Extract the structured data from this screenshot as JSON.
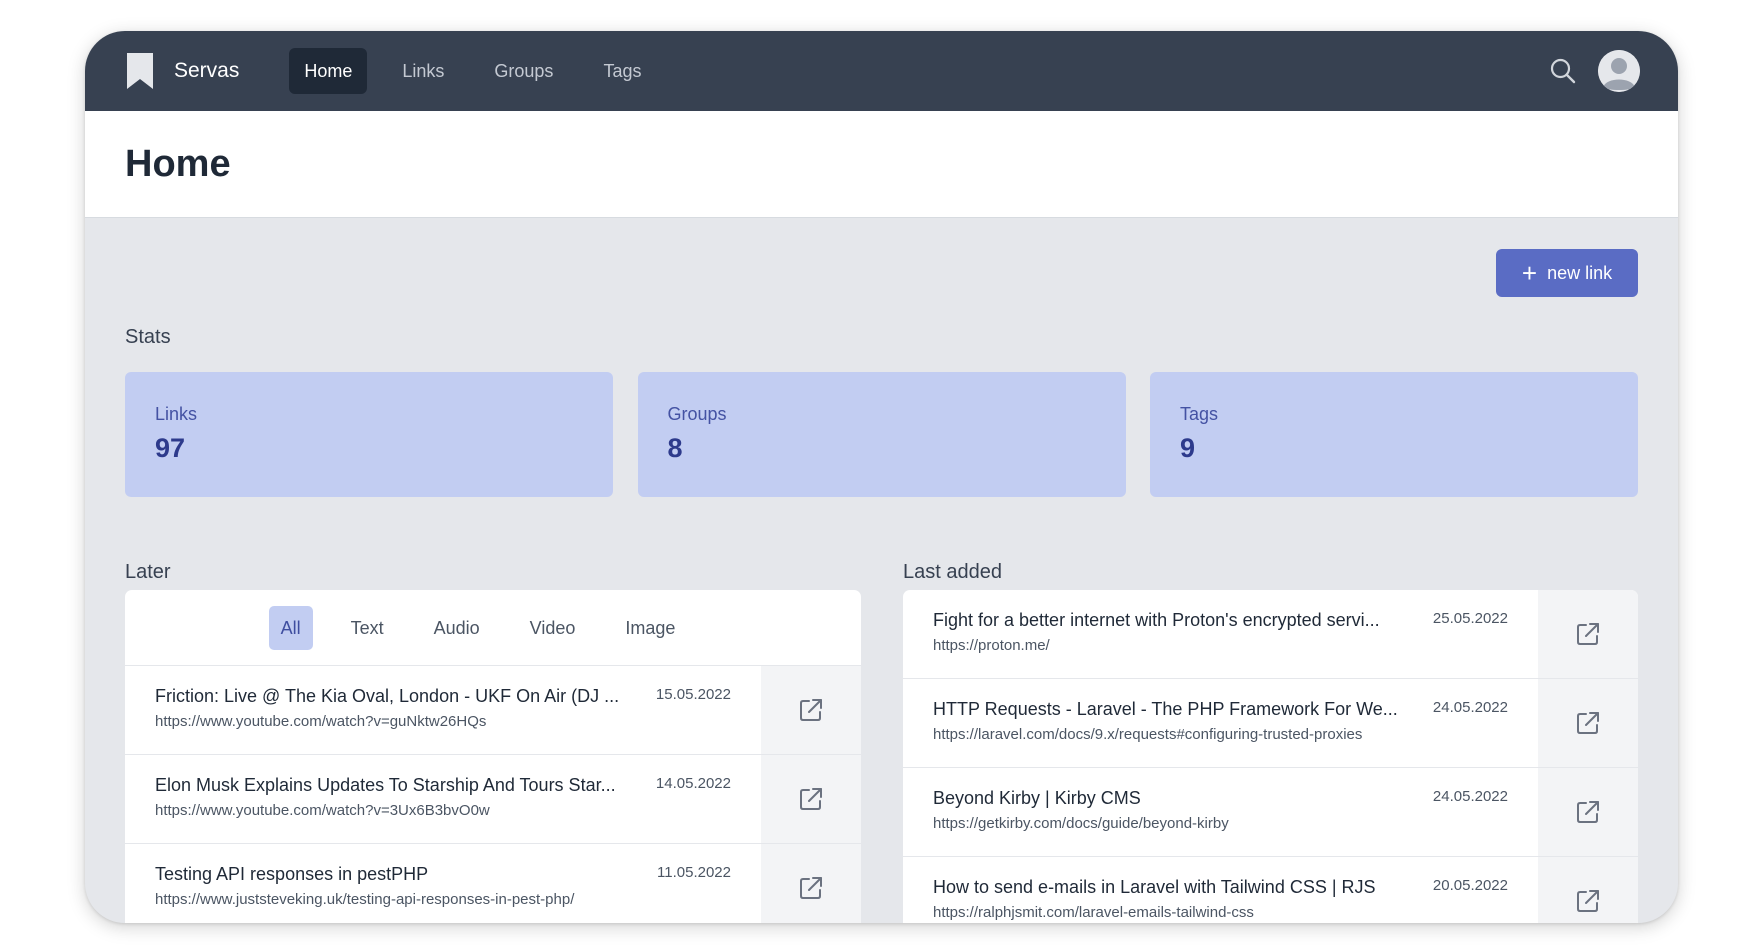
{
  "nav": {
    "brand": "Servas",
    "links": [
      {
        "label": "Home",
        "active": true
      },
      {
        "label": "Links",
        "active": false
      },
      {
        "label": "Groups",
        "active": false
      },
      {
        "label": "Tags",
        "active": false
      }
    ],
    "icons": {
      "search": "search-icon",
      "avatar": "user-avatar-icon",
      "logo": "bookmark-icon"
    }
  },
  "header": {
    "title": "Home"
  },
  "actions": {
    "new_link_label": "new link",
    "new_link_icon": "plus-icon"
  },
  "stats": {
    "label": "Stats",
    "cards": [
      {
        "label": "Links",
        "value": "97"
      },
      {
        "label": "Groups",
        "value": "8"
      },
      {
        "label": "Tags",
        "value": "9"
      }
    ]
  },
  "later": {
    "label": "Later",
    "filters": [
      {
        "label": "All",
        "active": true
      },
      {
        "label": "Text",
        "active": false
      },
      {
        "label": "Audio",
        "active": false
      },
      {
        "label": "Video",
        "active": false
      },
      {
        "label": "Image",
        "active": false
      }
    ],
    "items": [
      {
        "title": "Friction: Live @ The Kia Oval, London - UKF On Air (DJ ...",
        "url": "https://www.youtube.com/watch?v=guNktw26HQs",
        "date": "15.05.2022"
      },
      {
        "title": "Elon Musk Explains Updates To Starship And Tours Star...",
        "url": "https://www.youtube.com/watch?v=3Ux6B3bvO0w",
        "date": "14.05.2022"
      },
      {
        "title": "Testing API responses in pestPHP",
        "url": "https://www.juststeveking.uk/testing-api-responses-in-pest-php/",
        "date": "11.05.2022"
      }
    ]
  },
  "last_added": {
    "label": "Last added",
    "items": [
      {
        "title": "Fight for a better internet with Proton's encrypted servi...",
        "url": "https://proton.me/",
        "date": "25.05.2022"
      },
      {
        "title": "HTTP Requests - Laravel - The PHP Framework For We...",
        "url": "https://laravel.com/docs/9.x/requests#configuring-trusted-proxies",
        "date": "24.05.2022"
      },
      {
        "title": "Beyond Kirby | Kirby CMS",
        "url": "https://getkirby.com/docs/guide/beyond-kirby",
        "date": "24.05.2022"
      },
      {
        "title": "How to send e-mails in Laravel with Tailwind CSS | RJS",
        "url": "https://ralphjsmit.com/laravel-emails-tailwind-css",
        "date": "20.05.2022"
      }
    ]
  },
  "colors": {
    "nav_bg": "#374151",
    "accent": "#5a6cc4",
    "stat_card_bg": "#c2cdf2",
    "page_bg": "#e5e7eb"
  }
}
